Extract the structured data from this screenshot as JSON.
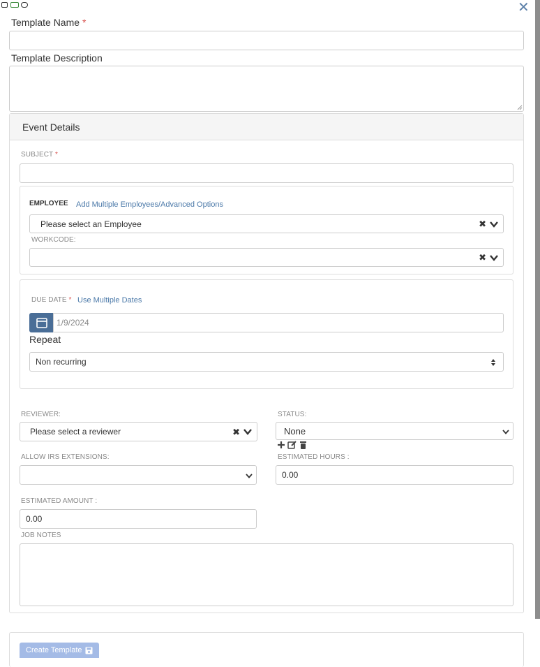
{
  "dialog": {
    "template_name_label": "Template Name",
    "template_description_label": "Template Description",
    "required_mark": "*"
  },
  "event_details": {
    "title": "Event Details",
    "subject_label": "SUBJECT",
    "employee_label": "EMPLOYEE",
    "employee_link": "Add Multiple Employees/Advanced Options",
    "employee_placeholder": "Please select an Employee",
    "workcode_label": "WORKCODE:",
    "due_date_label": "DUE DATE",
    "due_date_link": "Use Multiple Dates",
    "due_date_value": "1/9/2024",
    "repeat_label": "Repeat",
    "repeat_value": "Non recurring",
    "reviewer_label": "REVIEWER:",
    "reviewer_placeholder": "Please select a reviewer",
    "status_label": "STATUS:",
    "status_value": "None",
    "allow_irs_label": "ALLOW IRS EXTENSIONS:",
    "allow_irs_value": "",
    "estimated_hours_label": "ESTIMATED HOURS :",
    "estimated_hours_value": "0.00",
    "estimated_amount_label": "ESTIMATED AMOUNT :",
    "estimated_amount_value": "0.00",
    "job_notes_label": "JOB NOTES"
  },
  "footer": {
    "create_button_label": "Create Template"
  },
  "icons": {
    "close": "close-icon",
    "clear": "clear-icon",
    "chevron": "chevron-down-icon",
    "calendar": "calendar-icon",
    "add": "plus-icon",
    "edit": "edit-icon",
    "delete": "trash-icon",
    "save": "floppy-disk-icon"
  },
  "colors": {
    "accent": "#4a6e97",
    "link": "#4a78a8",
    "required": "#d9534f",
    "button_disabled": "#a4bbe6"
  }
}
